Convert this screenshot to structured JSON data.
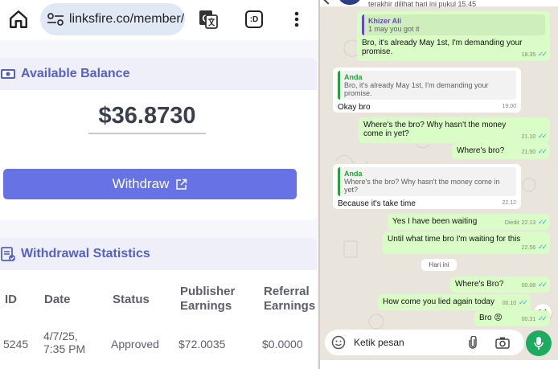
{
  "browser": {
    "url": "linksfire.co/member/",
    "tabs_count": ":D"
  },
  "balance": {
    "heading": "Available Balance",
    "amount": "$36.8730",
    "withdraw_label": "Withdraw"
  },
  "stats": {
    "heading": "Withdrawal Statistics",
    "columns": [
      "ID",
      "Date",
      "Status",
      "Publisher Earnings",
      "Referral Earnings"
    ],
    "rows": [
      {
        "id": "5245",
        "date": "4/7/25, 7:35 PM",
        "status": "Approved",
        "publisher": "$72.0035",
        "referral": "$0.0000"
      }
    ]
  },
  "chat": {
    "header_status": "terakhir dilihat hari ini pukul 15.45",
    "day_divider": "Hari ini",
    "input_placeholder": "Ketik pesan",
    "messages": [
      {
        "dir": "out",
        "quote_name": "Khizer Ali",
        "quote_text": "1 may you got it",
        "text": "Bro, it's already May 1st, I'm demanding your promise.",
        "time": "18.35"
      },
      {
        "dir": "in",
        "quote_name": "Anda",
        "quote_text": "Bro, it's already May 1st, I'm demanding your promise.",
        "text": "Okay bro",
        "time": "19.00"
      },
      {
        "dir": "out",
        "text": "Where's the bro? Why hasn't the money come in yet?",
        "time": "21.10"
      },
      {
        "dir": "out",
        "text": "Where's bro?",
        "time": "21.50"
      },
      {
        "dir": "in",
        "quote_name": "Anda",
        "quote_text": "Where's the bro? Why hasn't the money come in yet?",
        "text": "Because it's take time",
        "time": "22.12"
      },
      {
        "dir": "out",
        "text": "Yes I have been waiting",
        "edited": "Diedit",
        "time": "22.13"
      },
      {
        "dir": "out",
        "text": "Until what time bro I'm waiting for this",
        "time": "22.56"
      },
      {
        "dir": "out",
        "text": "Where's Bro?",
        "time": "00.08"
      },
      {
        "dir": "out",
        "text": "How come you lied again today",
        "time": "00.10"
      },
      {
        "dir": "out",
        "text": "Bro 😡",
        "time": "00.31"
      }
    ]
  },
  "colors": {
    "accent": "#6772e5",
    "accent_text": "#5561c6",
    "chat_out": "#dafcc6",
    "chat_bg": "#e9e4dc",
    "mic": "#1daa61"
  }
}
